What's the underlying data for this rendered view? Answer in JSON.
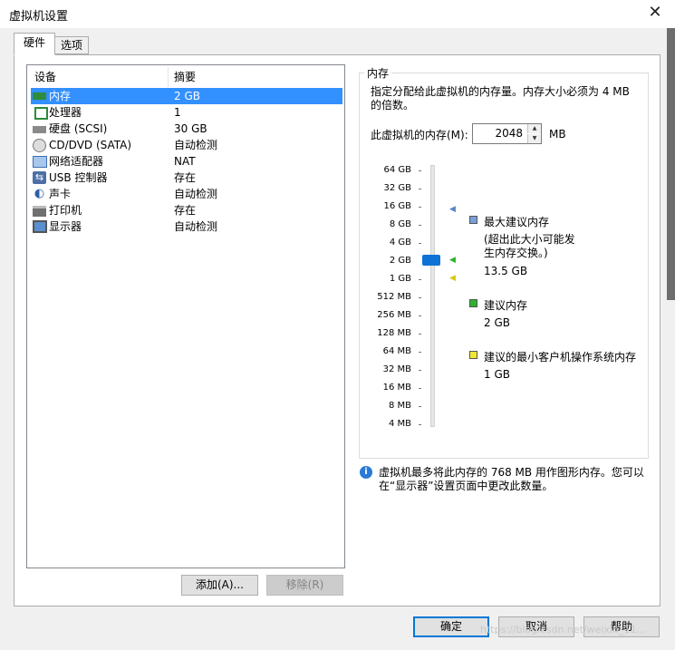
{
  "window": {
    "title": "虚拟机设置",
    "close_glyph": "✕"
  },
  "tabs": [
    {
      "label": "硬件",
      "active": true
    },
    {
      "label": "选项",
      "active": false
    }
  ],
  "device_table": {
    "headers": {
      "device": "设备",
      "summary": "摘要"
    },
    "rows": [
      {
        "icon": "memory-icon",
        "name": "内存",
        "summary": "2 GB",
        "selected": true
      },
      {
        "icon": "processor-icon",
        "name": "处理器",
        "summary": "1"
      },
      {
        "icon": "hard-disk-icon",
        "name": "硬盘 (SCSI)",
        "summary": "30 GB"
      },
      {
        "icon": "cd-dvd-icon",
        "name": "CD/DVD (SATA)",
        "summary": "自动检测"
      },
      {
        "icon": "network-adapter-icon",
        "name": "网络适配器",
        "summary": "NAT"
      },
      {
        "icon": "usb-icon",
        "name": "USB 控制器",
        "summary": "存在"
      },
      {
        "icon": "sound-card-icon",
        "name": "声卡",
        "summary": "自动检测"
      },
      {
        "icon": "printer-icon",
        "name": "打印机",
        "summary": "存在"
      },
      {
        "icon": "display-icon",
        "name": "显示器",
        "summary": "自动检测"
      }
    ]
  },
  "list_buttons": {
    "add": "添加(A)...",
    "remove": "移除(R)"
  },
  "memory": {
    "group_title": "内存",
    "description": "指定分配给此虚拟机的内存量。内存大小必须为 4 MB 的倍数。",
    "field_label": "此虚拟机的内存(M):",
    "value": "2048",
    "unit": "MB",
    "scale": [
      "64 GB",
      "32 GB",
      "16 GB",
      "8 GB",
      "4 GB",
      "2 GB",
      "1 GB",
      "512 MB",
      "256 MB",
      "128 MB",
      "64 MB",
      "32 MB",
      "16 MB",
      "8 MB",
      "4 MB"
    ],
    "slider_value": "2 GB",
    "legend": {
      "max_label": "最大建议内存",
      "max_note": "(超出此大小可能发生内存交换。)",
      "max_value": "13.5 GB",
      "max_color": "#7b9fd8",
      "rec_label": "建议内存",
      "rec_value": "2 GB",
      "rec_color": "#2db22d",
      "min_label": "建议的最小客户机操作系统内存",
      "min_value": "1 GB",
      "min_color": "#f2e632"
    },
    "info_text": "虚拟机最多将此内存的 768 MB 用作图形内存。您可以在“显示器”设置页面中更改此数量。"
  },
  "footer_buttons": {
    "ok": "确定",
    "cancel": "取消",
    "help": "帮助"
  },
  "watermark": "https://blog.csdn.net/weixin_11..."
}
